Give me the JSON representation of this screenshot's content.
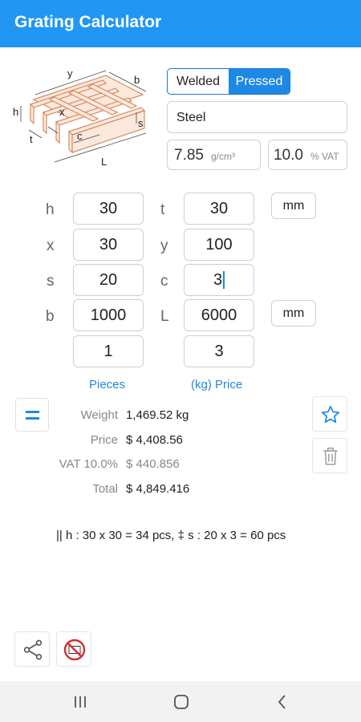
{
  "app": {
    "title": "Grating Calculator"
  },
  "diagram": {
    "labels": {
      "y": "y",
      "b": "b",
      "h": "h",
      "x": "x",
      "s": "s",
      "t": "t",
      "c": "c",
      "L": "L"
    }
  },
  "type_toggle": {
    "options": [
      "Welded",
      "Pressed"
    ],
    "selected": "Pressed"
  },
  "material": {
    "value": "Steel"
  },
  "density": {
    "value": "7.85",
    "unit": "g/cm³"
  },
  "vat": {
    "value": "10.0",
    "unit": "% VAT"
  },
  "inputs": {
    "h": {
      "label": "h",
      "value": "30"
    },
    "t": {
      "label": "t",
      "value": "30"
    },
    "x": {
      "label": "x",
      "value": "30"
    },
    "y": {
      "label": "y",
      "value": "100"
    },
    "s": {
      "label": "s",
      "value": "20"
    },
    "c": {
      "label": "c",
      "value": "3"
    },
    "b": {
      "label": "b",
      "value": "1000"
    },
    "L": {
      "label": "L",
      "value": "6000"
    },
    "pieces": {
      "value": "1",
      "caption": "Pieces"
    },
    "price": {
      "value": "3",
      "caption": "(kg) Price"
    }
  },
  "units": {
    "top": "mm",
    "bottom": "mm"
  },
  "results": {
    "weight": {
      "label": "Weight",
      "value": "1,469.52 kg"
    },
    "price": {
      "label": "Price",
      "value": "$ 4,408.56"
    },
    "vat": {
      "label": "VAT 10.0%",
      "value": "$ 440.856"
    },
    "total": {
      "label": "Total",
      "value": "$ 4,849.416"
    }
  },
  "formula": "|| h : 30 x 30 = 34 pcs, ‡ s : 20 x 3 = 60 pcs",
  "colors": {
    "primary": "#2196f3",
    "accent": "#1e88e5",
    "wood": "#e8a27a",
    "no_ads_red": "#d32f2f"
  },
  "icons": {
    "calc": "equals-icon",
    "favorite": "star-icon",
    "delete": "trash-icon",
    "share": "share-icon",
    "no_ads": "no-ads-icon"
  },
  "nav": [
    "recents-icon",
    "home-icon",
    "back-icon"
  ]
}
